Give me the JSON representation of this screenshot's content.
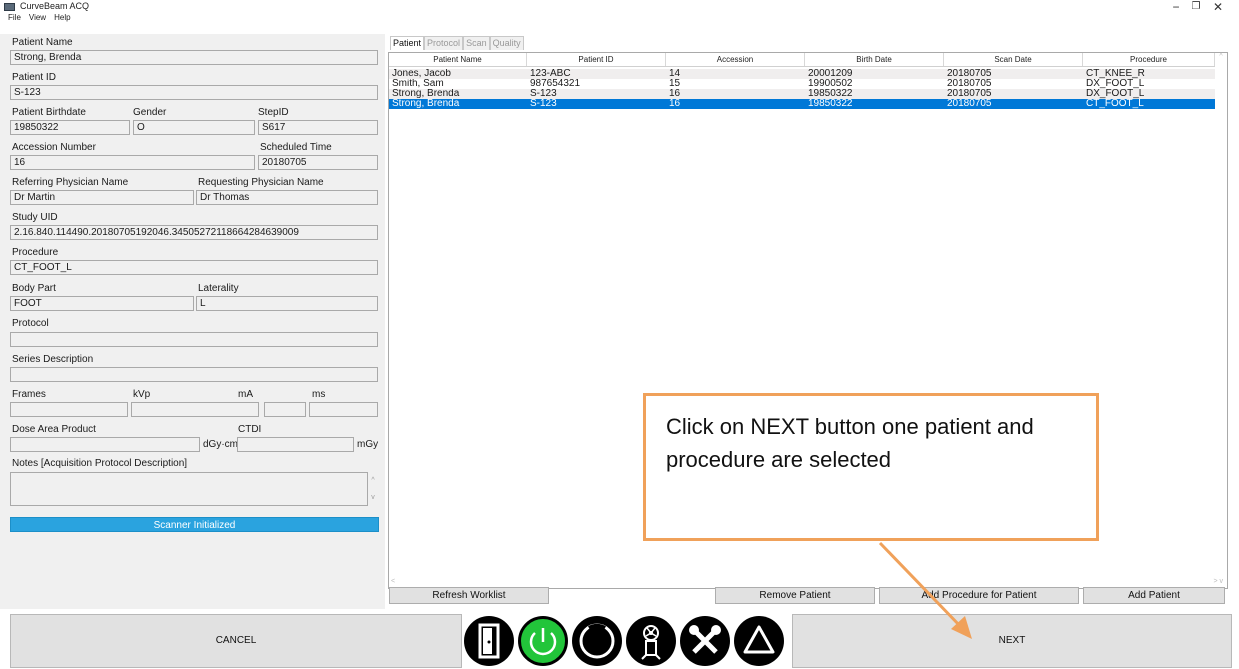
{
  "window": {
    "title": "CurveBeam ACQ",
    "minimize": "−",
    "maximize": "❐",
    "close": "✕"
  },
  "menu": [
    "File",
    "View",
    "Help"
  ],
  "form": {
    "patient_name_label": "Patient Name",
    "patient_name": "Strong, Brenda",
    "patient_id_label": "Patient ID",
    "patient_id": "S-123",
    "birthdate_label": "Patient Birthdate",
    "birthdate": "19850322",
    "gender_label": "Gender",
    "gender": "O",
    "stepid_label": "StepID",
    "stepid": "S617",
    "accession_label": "Accession Number",
    "accession": "16",
    "scheduled_label": "Scheduled Time",
    "scheduled": "20180705",
    "referring_label": "Referring Physician Name",
    "referring": "Dr Martin",
    "requesting_label": "Requesting Physician Name",
    "requesting": "Dr Thomas",
    "study_uid_label": "Study UID",
    "study_uid": "2.16.840.114490.20180705192046.345052721186642846390​09",
    "procedure_label": "Procedure",
    "procedure": "CT_FOOT_L",
    "body_part_label": "Body Part",
    "body_part": "FOOT",
    "laterality_label": "Laterality",
    "laterality": "L",
    "protocol_label": "Protocol",
    "protocol": "",
    "series_label": "Series Description",
    "series": "",
    "frames_label": "Frames",
    "kvp_label": "kVp",
    "ma_label": "mA",
    "ms_label": "ms",
    "dap_label": "Dose Area Product",
    "dap_unit": "dGy·cm²",
    "ctdi_label": "CTDI",
    "ctdi_unit": "mGy",
    "notes_label": "Notes [Acquisition Protocol Description]"
  },
  "status": "Scanner Initialized",
  "tabs": [
    "Patient",
    "Protocol",
    "Scan",
    "Quality"
  ],
  "table": {
    "columns": [
      "Patient Name",
      "Patient ID",
      "Accession",
      "Birth Date",
      "Scan Date",
      "Procedure"
    ],
    "rows": [
      [
        "Jones, Jacob",
        "123-ABC",
        "14",
        "20001209",
        "20180705",
        "CT_KNEE_R"
      ],
      [
        "Smith, Sam",
        "987654321",
        "15",
        "19900502",
        "20180705",
        "DX_FOOT_L"
      ],
      [
        "Strong, Brenda",
        "S-123",
        "16",
        "19850322",
        "20180705",
        "DX_FOOT_L"
      ],
      [
        "Strong, Brenda",
        "S-123",
        "16",
        "19850322",
        "20180705",
        "CT_FOOT_L"
      ]
    ],
    "selected_row": 3
  },
  "buttons": {
    "refresh": "Refresh Worklist",
    "remove": "Remove Patient",
    "add_procedure": "Add Procedure for Patient",
    "add_patient": "Add Patient",
    "cancel": "CANCEL",
    "next": "NEXT"
  },
  "icons": [
    "door-icon",
    "power-icon",
    "refresh-ring-icon",
    "radiation-person-icon",
    "tools-icon",
    "warning-icon"
  ],
  "colors": {
    "accent": "#0078d7",
    "status": "#2aa3df",
    "power": "#22c53a",
    "callout_border": "#f0a15a"
  },
  "callout": {
    "text": "Click on NEXT button one patient and procedure are selected"
  }
}
